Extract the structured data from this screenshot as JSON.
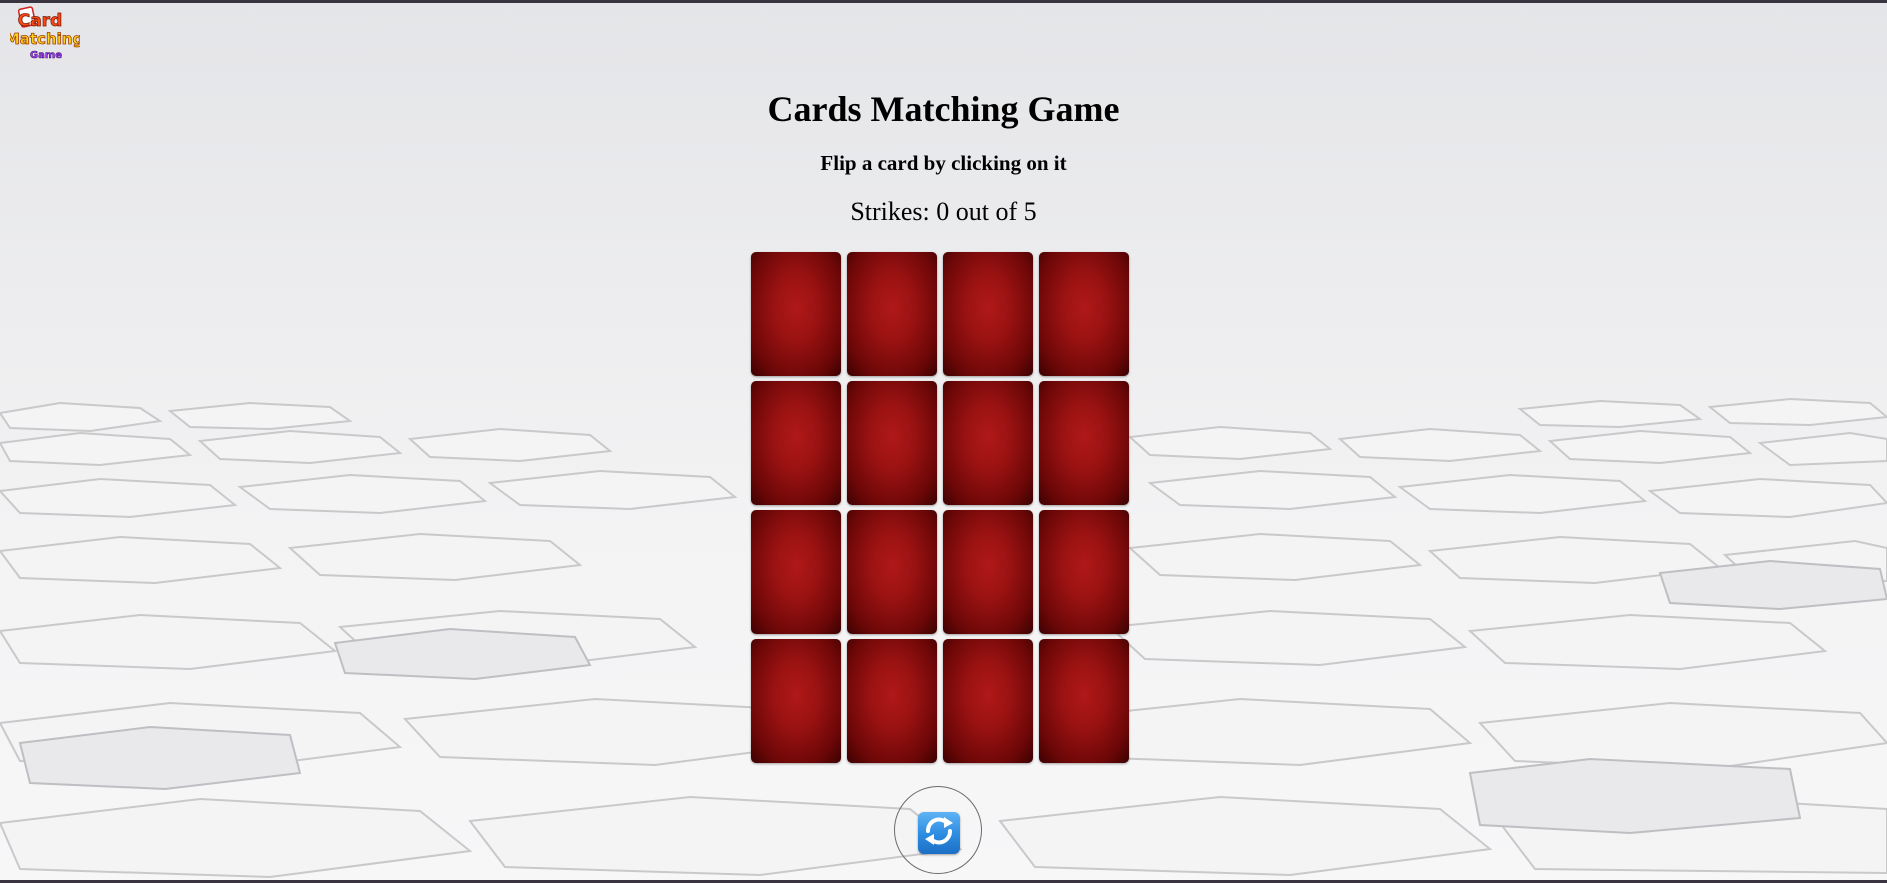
{
  "app": {
    "logo_text_line1": "Card",
    "logo_text_line2": "Matching",
    "logo_text_line3": "Game",
    "title": "Cards Matching Game",
    "instruction": "Flip a card by clicking on it",
    "strikes_text": "Strikes: 0 out of 5"
  },
  "board": {
    "rows": 4,
    "columns": 4,
    "cards": [
      {
        "state": "face-down"
      },
      {
        "state": "face-down"
      },
      {
        "state": "face-down"
      },
      {
        "state": "face-down"
      },
      {
        "state": "face-down"
      },
      {
        "state": "face-down"
      },
      {
        "state": "face-down"
      },
      {
        "state": "face-down"
      },
      {
        "state": "face-down"
      },
      {
        "state": "face-down"
      },
      {
        "state": "face-down"
      },
      {
        "state": "face-down"
      },
      {
        "state": "face-down"
      },
      {
        "state": "face-down"
      },
      {
        "state": "face-down"
      },
      {
        "state": "face-down"
      }
    ],
    "card_back_color": "#9a1212"
  },
  "controls": {
    "restart_icon": "refresh-icon",
    "restart_color": "#2b8be0"
  }
}
